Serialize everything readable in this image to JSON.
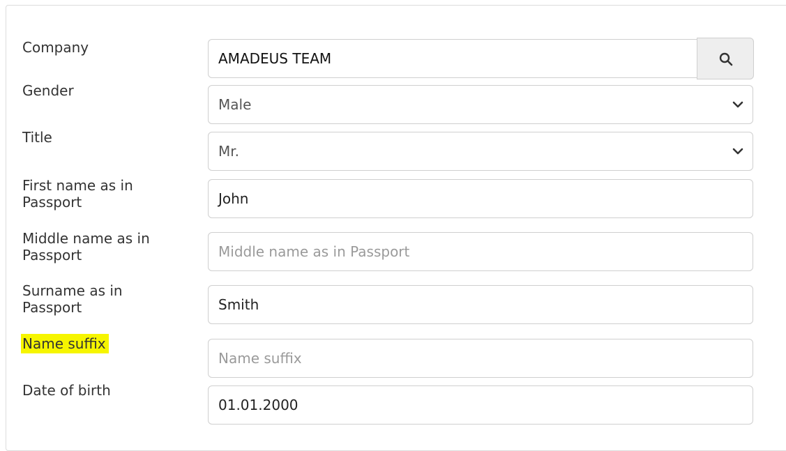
{
  "form": {
    "company": {
      "label": "Company",
      "value": "AMADEUS TEAM",
      "search_icon": "search-icon"
    },
    "gender": {
      "label": "Gender",
      "selected": "Male",
      "dropdown_icon": "chevron-down-icon"
    },
    "title": {
      "label": "Title",
      "selected": "Mr.",
      "dropdown_icon": "chevron-down-icon"
    },
    "first_name": {
      "label_line1": "First name as in",
      "label_line2": "Passport",
      "value": "John"
    },
    "middle_name": {
      "label_line1": "Middle name as in",
      "label_line2": "Passport",
      "placeholder": "Middle name as in Passport"
    },
    "surname": {
      "label_line1": "Surname as in",
      "label_line2": "Passport",
      "value": "Smith"
    },
    "name_suffix": {
      "label": "Name suffix",
      "placeholder": "Name suffix",
      "highlight_color": "#f6f500"
    },
    "dob": {
      "label": "Date of birth",
      "value": "01.01.2000"
    }
  },
  "colors": {
    "border": "#cfcfcf",
    "label_text": "#333333",
    "placeholder_text": "#9a9a9a",
    "search_button_bg": "#eeeeee"
  }
}
